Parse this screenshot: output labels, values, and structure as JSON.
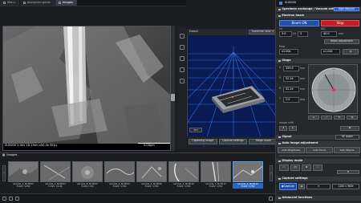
{
  "tabs": [
    {
      "label": "Menu",
      "icon": "menu-icon",
      "active": false
    },
    {
      "label": "Advanced guide",
      "icon": "guide-icon",
      "active": false
    },
    {
      "label": "Images",
      "icon": "images-icon",
      "active": true
    }
  ],
  "sem": {
    "mag_value": "x60.0k",
    "detector": "SE Lower",
    "info_bar": "SU5000 5.0kV 18.1mm x50.0k SE(L)",
    "scale_label": "5.00µm"
  },
  "detail": {
    "title": "Detail",
    "view_select": "Specimen stub",
    "buttons": [
      "Capturing image",
      "Capture settings",
      "Stage move"
    ]
  },
  "images_strip": {
    "title": "Images",
    "items": [
      {
        "name": "sample_A_No0002",
        "info": "5.0kV, x250",
        "selected": false
      },
      {
        "name": "sample_A_No0003",
        "info": "5.0kV, x1.0k",
        "selected": false
      },
      {
        "name": "sample_B_No0005",
        "info": "5.0kV, x50",
        "selected": false
      },
      {
        "name": "sample_A_No0004",
        "info": "5.0kV, x700",
        "selected": false
      },
      {
        "name": "sample_A_No0006",
        "info": "5.0kV, x700",
        "selected": false
      },
      {
        "name": "sample_A_No0010",
        "info": "5.0kV, x700",
        "selected": false
      },
      {
        "name": "sample_A_No0011",
        "info": "5.0kV, x750",
        "selected": false
      },
      {
        "name": "sample_A_No0012",
        "info": "5.0kV, x750",
        "selected": true
      }
    ]
  },
  "panel": {
    "logo_name": "SU5000",
    "section_specimen": "Specimen exchange / Vacuum setting",
    "high_vacuum_badge": "High Vacuum",
    "section_beam": "Electron beam",
    "beam_on_label": "Beam ON",
    "stop_label": "Stop",
    "accel_value": "3.0",
    "accel_unit": "kV",
    "wd_value": "40.0",
    "wd_unit": "mm",
    "spot_value": "3",
    "beam_adjustment": "Beam adjustment",
    "mag_value": "x1.00k",
    "mag_unit": "x",
    "x_value": "339.9",
    "x_unit": "mm",
    "y_value": "52.24",
    "y_unit": "mm",
    "r_value": "52.24",
    "r_unit": "mm",
    "r_deg": "0.0",
    "t_value": "2.0",
    "t_unit": "deg",
    "section_signal": "Signal",
    "signal_value": "SE Lower",
    "section_auto_adjust": "Auto image adjustment",
    "auto_buttons": [
      "Auto Brightness",
      "Auto Focus",
      "Auto Stigma"
    ],
    "section_display_mode": "Display mode",
    "section_capture": "Capture settings",
    "capture_label": "Capture",
    "capture_select": "1280 x 960",
    "section_advanced": "Advanced functions"
  }
}
